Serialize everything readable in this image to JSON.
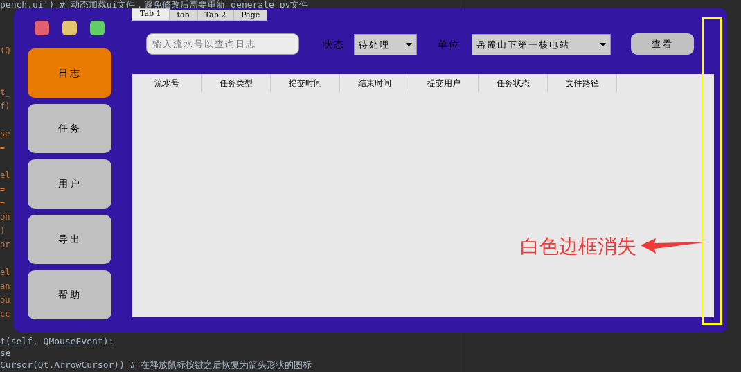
{
  "editor": {
    "top_line": "pench.ui')  # 动态加载ui文件，避免修改后需要重新 generate py文件",
    "edge_lines": [
      "(Q",
      "t_",
      "f)",
      "se",
      "=",
      "el",
      "=",
      "=",
      "on",
      ")",
      "or",
      "el",
      "an",
      "ou",
      "cc"
    ],
    "bottom_lines": [
      "t(self, QMouseEvent):",
      "se",
      "Cursor(Qt.ArrowCursor))  # 在释放鼠标按键之后恢复为箭头形状的图标"
    ]
  },
  "window": {
    "tabs": [
      {
        "label": "Tab 1",
        "selected": true
      },
      {
        "label": "tab",
        "selected": false
      },
      {
        "label": "Tab 2",
        "selected": false
      },
      {
        "label": "Page",
        "selected": false
      }
    ],
    "window_controls": [
      {
        "color": "#e06070"
      },
      {
        "color": "#e4c46c"
      },
      {
        "color": "#62cc66"
      }
    ],
    "sidebar": [
      {
        "label": "日志",
        "selected": true
      },
      {
        "label": "任务",
        "selected": false
      },
      {
        "label": "用户",
        "selected": false
      },
      {
        "label": "导出",
        "selected": false
      },
      {
        "label": "帮助",
        "selected": false
      }
    ],
    "search": {
      "placeholder": "输入流水号以查询日志"
    },
    "status_filter": {
      "label": "状态",
      "value": "待处理"
    },
    "unit_filter": {
      "label": "单位",
      "value": "岳麓山下第一核电站"
    },
    "view_button": "查看",
    "table": {
      "columns": [
        "流水号",
        "任务类型",
        "提交时间",
        "结束时间",
        "提交用户",
        "任务状态",
        "文件路径"
      ]
    }
  },
  "annotation": {
    "text": "白色边框消失"
  }
}
